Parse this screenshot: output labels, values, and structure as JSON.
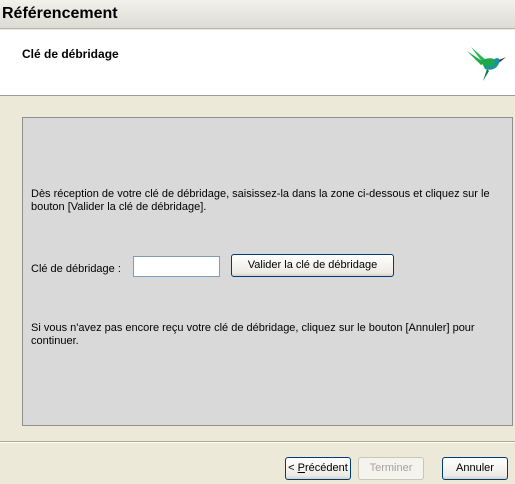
{
  "window": {
    "title": "Référencement"
  },
  "header": {
    "title": "Clé de débridage",
    "logo_icon": "hummingbird-icon"
  },
  "content": {
    "instruction": "Dès réception de votre clé de débridage, saisissez-la dans la zone ci-dessous et cliquez sur le bouton [Valider la clé de débridage].",
    "key_label": "Clé de débridage :",
    "key_value": "",
    "validate_button": "Valider la clé de débridage",
    "note": "Si vous n'avez pas encore reçu votre clé de débridage, cliquez sur le bouton [Annuler] pour continuer."
  },
  "footer": {
    "prev_prefix": "< ",
    "prev_accel": "P",
    "prev_rest": "récédent",
    "finish_button": "Terminer",
    "cancel_button": "Annuler"
  },
  "colors": {
    "bird_green": "#1fa84a",
    "bird_teal": "#1a8fb0"
  }
}
